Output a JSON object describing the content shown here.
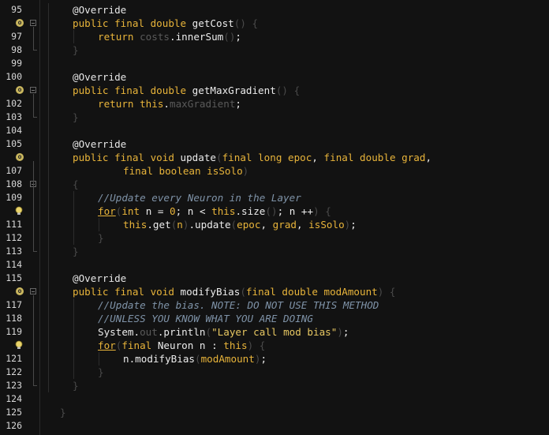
{
  "editor": {
    "lines": [
      {
        "n": "95",
        "code": [
          [
            "ann",
            "@Override"
          ]
        ],
        "indent": 1
      },
      {
        "n": "",
        "badge": "o",
        "fold": "open",
        "code": [
          [
            "kw",
            "public "
          ],
          [
            "kw",
            "final "
          ],
          [
            "kw",
            "double "
          ],
          [
            "plain",
            "getCost"
          ],
          [
            "dim",
            "() "
          ],
          [
            "dim",
            "{"
          ]
        ],
        "indent": 1
      },
      {
        "n": "97",
        "code": [
          [
            "kw",
            "return "
          ],
          [
            "fld",
            "costs"
          ],
          [
            "plain",
            ".innerSum"
          ],
          [
            "dim",
            "()"
          ],
          [
            "plain",
            ";"
          ]
        ],
        "indent": 2
      },
      {
        "n": "98",
        "code": [
          [
            "dim",
            "}"
          ]
        ],
        "indent": 1,
        "foldEnd": true
      },
      {
        "n": "99",
        "code": [],
        "indent": 0
      },
      {
        "n": "100",
        "code": [
          [
            "ann",
            "@Override"
          ]
        ],
        "indent": 1
      },
      {
        "n": "",
        "badge": "o",
        "fold": "open",
        "code": [
          [
            "kw",
            "public "
          ],
          [
            "kw",
            "final "
          ],
          [
            "kw",
            "double "
          ],
          [
            "plain",
            "getMaxGradient"
          ],
          [
            "dim",
            "() "
          ],
          [
            "dim",
            "{"
          ]
        ],
        "indent": 1
      },
      {
        "n": "102",
        "code": [
          [
            "kw",
            "return "
          ],
          [
            "kw",
            "this"
          ],
          [
            "plain",
            "."
          ],
          [
            "fld",
            "maxGradient"
          ],
          [
            "plain",
            ";"
          ]
        ],
        "indent": 2
      },
      {
        "n": "103",
        "code": [
          [
            "dim",
            "}"
          ]
        ],
        "indent": 1,
        "foldEnd": true
      },
      {
        "n": "104",
        "code": [],
        "indent": 0
      },
      {
        "n": "105",
        "code": [
          [
            "ann",
            "@Override"
          ]
        ],
        "indent": 1
      },
      {
        "n": "",
        "badge": "o",
        "code": [
          [
            "kw",
            "public "
          ],
          [
            "kw",
            "final "
          ],
          [
            "kw",
            "void "
          ],
          [
            "plain",
            "update"
          ],
          [
            "dim",
            "("
          ],
          [
            "kw",
            "final "
          ],
          [
            "kw",
            "long "
          ],
          [
            "par",
            "epoc"
          ],
          [
            "plain",
            ", "
          ],
          [
            "kw",
            "final "
          ],
          [
            "kw",
            "double "
          ],
          [
            "par",
            "grad"
          ],
          [
            "plain",
            ","
          ]
        ],
        "indent": 1
      },
      {
        "n": "107",
        "code": [
          [
            "kw",
            "final "
          ],
          [
            "kw",
            "boolean "
          ],
          [
            "par",
            "isSolo"
          ],
          [
            "dim",
            ")"
          ]
        ],
        "indent": 3
      },
      {
        "n": "108",
        "fold": "open",
        "code": [
          [
            "dim",
            "{"
          ]
        ],
        "indent": 1
      },
      {
        "n": "109",
        "code": [
          [
            "cmt",
            "//Update every Neuron in the Layer"
          ]
        ],
        "indent": 2
      },
      {
        "n": "",
        "bulb": true,
        "code": [
          [
            "kwu",
            "for"
          ],
          [
            "dim",
            "("
          ],
          [
            "kw",
            "int "
          ],
          [
            "plain",
            "n = "
          ],
          [
            "kw",
            "0"
          ],
          [
            "plain",
            "; n < "
          ],
          [
            "kw",
            "this"
          ],
          [
            "plain",
            ".size"
          ],
          [
            "dim",
            "()"
          ],
          [
            "plain",
            "; n ++"
          ],
          [
            "dim",
            ") "
          ],
          [
            "dim",
            "{"
          ]
        ],
        "indent": 2
      },
      {
        "n": "111",
        "code": [
          [
            "kw",
            "this"
          ],
          [
            "plain",
            ".get"
          ],
          [
            "dim",
            "("
          ],
          [
            "par",
            "n"
          ],
          [
            "dim",
            ")"
          ],
          [
            "plain",
            ".update"
          ],
          [
            "dim",
            "("
          ],
          [
            "par",
            "epoc"
          ],
          [
            "plain",
            ", "
          ],
          [
            "par",
            "grad"
          ],
          [
            "plain",
            ", "
          ],
          [
            "par",
            "isSolo"
          ],
          [
            "dim",
            ")"
          ],
          [
            "plain",
            ";"
          ]
        ],
        "indent": 3
      },
      {
        "n": "112",
        "code": [
          [
            "dim",
            "}"
          ]
        ],
        "indent": 2
      },
      {
        "n": "113",
        "code": [
          [
            "dim",
            "}"
          ]
        ],
        "indent": 1,
        "foldEnd": true
      },
      {
        "n": "114",
        "code": [],
        "indent": 0
      },
      {
        "n": "115",
        "code": [
          [
            "ann",
            "@Override"
          ]
        ],
        "indent": 1
      },
      {
        "n": "",
        "badge": "o",
        "fold": "open",
        "code": [
          [
            "kw",
            "public "
          ],
          [
            "kw",
            "final "
          ],
          [
            "kw",
            "void "
          ],
          [
            "plain",
            "modifyBias"
          ],
          [
            "dim",
            "("
          ],
          [
            "kw",
            "final "
          ],
          [
            "kw",
            "double "
          ],
          [
            "par",
            "modAmount"
          ],
          [
            "dim",
            ") "
          ],
          [
            "dim",
            "{"
          ]
        ],
        "indent": 1
      },
      {
        "n": "117",
        "code": [
          [
            "cmt",
            "//Update the bias. NOTE: DO NOT USE THIS METHOD"
          ]
        ],
        "indent": 2
      },
      {
        "n": "118",
        "code": [
          [
            "cmt",
            "//UNLESS YOU KNOW WHAT YOU ARE DOING"
          ]
        ],
        "indent": 2
      },
      {
        "n": "119",
        "code": [
          [
            "plain",
            "System."
          ],
          [
            "fld",
            "out"
          ],
          [
            "plain",
            ".println"
          ],
          [
            "dim",
            "("
          ],
          [
            "str",
            "\"Layer call mod bias\""
          ],
          [
            "dim",
            ")"
          ],
          [
            "plain",
            ";"
          ]
        ],
        "indent": 2
      },
      {
        "n": "",
        "bulb": true,
        "code": [
          [
            "kwu",
            "for"
          ],
          [
            "dim",
            "("
          ],
          [
            "kw",
            "final "
          ],
          [
            "plain",
            "Neuron n : "
          ],
          [
            "kw",
            "this"
          ],
          [
            "dim",
            ") "
          ],
          [
            "dim",
            "{"
          ]
        ],
        "indent": 2
      },
      {
        "n": "121",
        "code": [
          [
            "plain",
            "n.modifyBias"
          ],
          [
            "dim",
            "("
          ],
          [
            "par",
            "modAmount"
          ],
          [
            "dim",
            ")"
          ],
          [
            "plain",
            ";"
          ]
        ],
        "indent": 3
      },
      {
        "n": "122",
        "code": [
          [
            "dim",
            "}"
          ]
        ],
        "indent": 2
      },
      {
        "n": "123",
        "code": [
          [
            "dim",
            "}"
          ]
        ],
        "indent": 1,
        "foldEnd": true
      },
      {
        "n": "124",
        "code": [],
        "indent": 0
      },
      {
        "n": "125",
        "code": [
          [
            "dim",
            "}"
          ]
        ],
        "indent": 0.5
      },
      {
        "n": "126",
        "code": [],
        "indent": 0
      }
    ]
  },
  "icons": {
    "override_badge": "override-icon",
    "bulb": "lightbulb-hint-icon",
    "fold": "fold-toggle-icon"
  },
  "colors": {
    "keyword": "#e8b43a",
    "comment": "#7f93a8",
    "background": "#121212"
  }
}
